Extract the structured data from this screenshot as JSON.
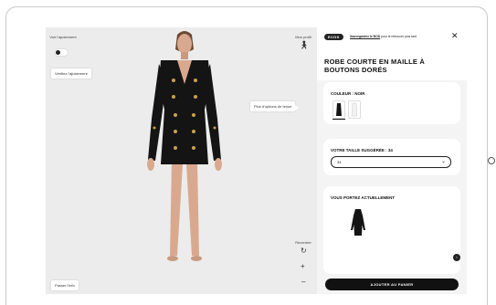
{
  "viewer": {
    "fit_toggle_label": "Voir l'ajustement",
    "check_fit_button": "Vérifiez l'ajustement",
    "my_profile_label": "Mon profil",
    "more_options_button": "Plus d'options de tenue",
    "recenter_label": "Recentrer",
    "pass_button": "Passer l'info"
  },
  "panel": {
    "logo": "ECOS",
    "signin_link": "Sauvegardez le BOD",
    "signin_suffix": " pour le retrouver plus tard",
    "product_title": "ROBE COURTE EN MAILLE À BOUTONS DORÉS",
    "color_section": {
      "title": "COULEUR : NOIR"
    },
    "size_section": {
      "title": "VOTRE TAILLE SUGGÉRÉE : 34",
      "selected": "34"
    },
    "wearing_section": {
      "title": "VOUS PORTEZ ACTUELLEMENT"
    },
    "cart_button": "AJOUTER AU PANIER"
  },
  "colors": {
    "dress": "#141414",
    "buttons": "#c9a24a",
    "skin": "#d9a98f",
    "background": "#ececec"
  }
}
